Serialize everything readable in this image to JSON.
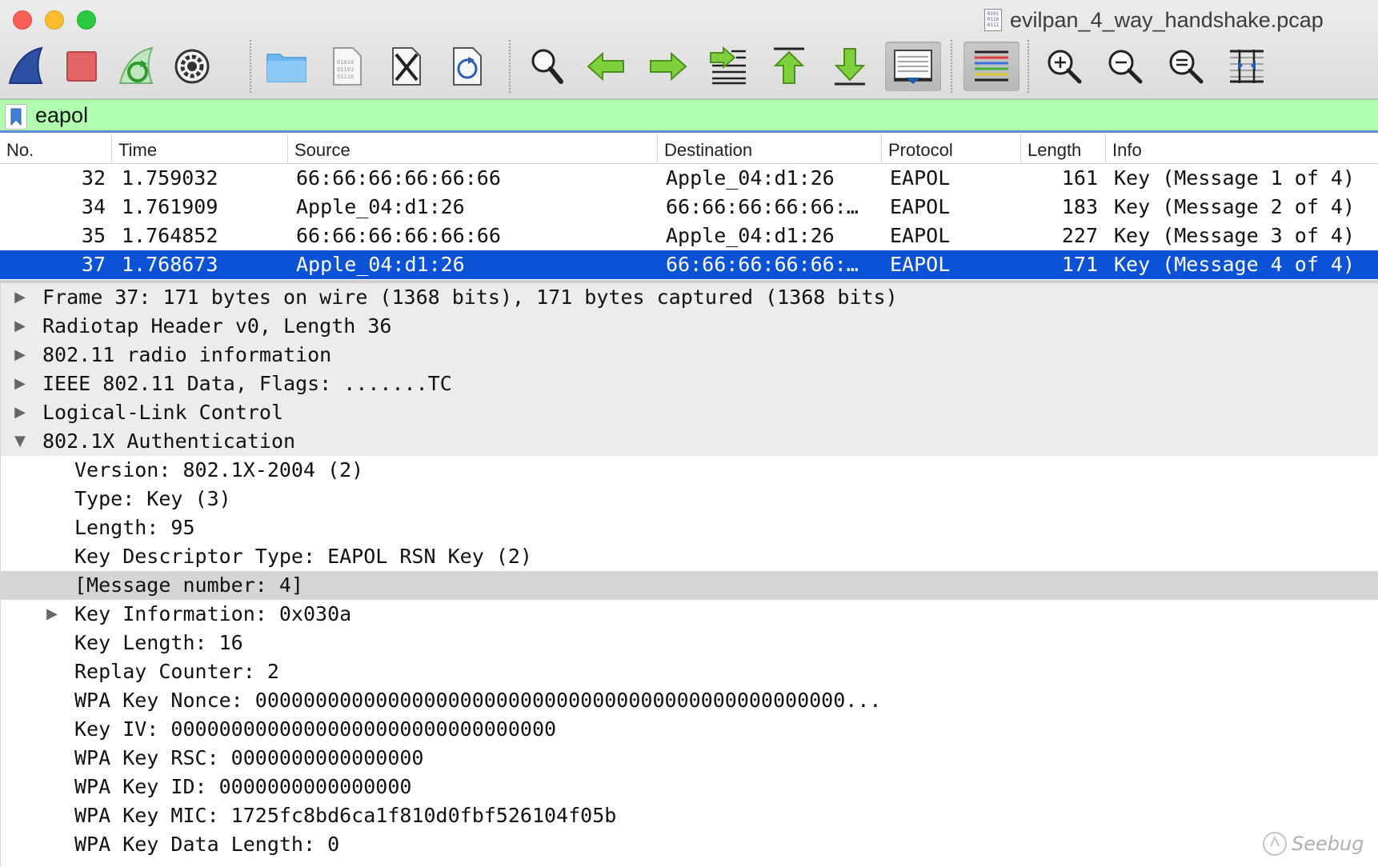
{
  "window": {
    "title": "evilpan_4_way_handshake.pcap",
    "file_icon_text": "0101\n0110\n0111"
  },
  "toolbar": {
    "buttons": [
      {
        "id": "start-capture",
        "icon": "shark-fin-icon"
      },
      {
        "id": "stop-capture",
        "icon": "stop-icon"
      },
      {
        "id": "restart-capture",
        "icon": "restart-icon"
      },
      {
        "id": "capture-options",
        "icon": "gear-icon"
      },
      {
        "id": "open-file",
        "icon": "folder-icon"
      },
      {
        "id": "save-file",
        "icon": "binary-file-icon"
      },
      {
        "id": "close-file",
        "icon": "close-file-icon"
      },
      {
        "id": "reload-file",
        "icon": "reload-file-icon"
      },
      {
        "id": "find-packet",
        "icon": "magnifier-icon"
      },
      {
        "id": "go-back",
        "icon": "arrow-left-icon"
      },
      {
        "id": "go-forward",
        "icon": "arrow-right-icon"
      },
      {
        "id": "go-to-packet",
        "icon": "jump-to-packet-icon"
      },
      {
        "id": "go-first",
        "icon": "arrow-up-icon"
      },
      {
        "id": "go-last",
        "icon": "arrow-down-icon"
      },
      {
        "id": "autoscroll",
        "icon": "autoscroll-icon"
      },
      {
        "id": "colorize",
        "icon": "colorize-icon"
      },
      {
        "id": "zoom-in",
        "icon": "zoom-in-icon"
      },
      {
        "id": "zoom-out",
        "icon": "zoom-out-icon"
      },
      {
        "id": "normal-size",
        "icon": "zoom-reset-icon"
      },
      {
        "id": "resize-columns",
        "icon": "resize-columns-icon"
      }
    ]
  },
  "filter": {
    "value": "eapol",
    "bookmark_icon": "bookmark-icon",
    "background": "#afffaf"
  },
  "packet_list": {
    "columns": [
      "No.",
      "Time",
      "Source",
      "Destination",
      "Protocol",
      "Length",
      "Info"
    ],
    "rows": [
      {
        "no": "32",
        "time": "1.759032",
        "source": "66:66:66:66:66:66",
        "destination": "Apple_04:d1:26",
        "protocol": "EAPOL",
        "length": "161",
        "info": "Key (Message 1 of 4)"
      },
      {
        "no": "34",
        "time": "1.761909",
        "source": "Apple_04:d1:26",
        "destination": "66:66:66:66:66:…",
        "protocol": "EAPOL",
        "length": "183",
        "info": "Key (Message 2 of 4)"
      },
      {
        "no": "35",
        "time": "1.764852",
        "source": "66:66:66:66:66:66",
        "destination": "Apple_04:d1:26",
        "protocol": "EAPOL",
        "length": "227",
        "info": "Key (Message 3 of 4)"
      },
      {
        "no": "37",
        "time": "1.768673",
        "source": "Apple_04:d1:26",
        "destination": "66:66:66:66:66:…",
        "protocol": "EAPOL",
        "length": "171",
        "info": "Key (Message 4 of 4)"
      }
    ],
    "selected_color": "#0b52d6"
  },
  "detail_tree": {
    "items": [
      {
        "text": "Frame 37: 171 bytes on wire (1368 bits), 171 bytes captured (1368 bits)",
        "arrow": "▶"
      },
      {
        "text": "Radiotap Header v0, Length 36",
        "arrow": "▶"
      },
      {
        "text": "802.11 radio information",
        "arrow": "▶"
      },
      {
        "text": "IEEE 802.11 Data, Flags: .......TC",
        "arrow": "▶"
      },
      {
        "text": "Logical-Link Control",
        "arrow": "▶"
      },
      {
        "text": "802.1X Authentication",
        "arrow": "▼"
      },
      {
        "text": "Version: 802.1X-2004 (2)",
        "arrow": ""
      },
      {
        "text": "Type: Key (3)",
        "arrow": ""
      },
      {
        "text": "Length: 95",
        "arrow": ""
      },
      {
        "text": "Key Descriptor Type: EAPOL RSN Key (2)",
        "arrow": ""
      },
      {
        "text": "[Message number: 4]",
        "arrow": ""
      },
      {
        "text": "Key Information: 0x030a",
        "arrow": "▶"
      },
      {
        "text": "Key Length: 16",
        "arrow": ""
      },
      {
        "text": "Replay Counter: 2",
        "arrow": ""
      },
      {
        "text": "WPA Key Nonce: 0000000000000000000000000000000000000000000000000...",
        "arrow": ""
      },
      {
        "text": "Key IV: 00000000000000000000000000000000",
        "arrow": ""
      },
      {
        "text": "WPA Key RSC: 0000000000000000",
        "arrow": ""
      },
      {
        "text": "WPA Key ID: 0000000000000000",
        "arrow": ""
      },
      {
        "text": "WPA Key MIC: 1725fc8bd6ca1f810d0fbf526104f05b",
        "arrow": ""
      },
      {
        "text": "WPA Key Data Length: 0",
        "arrow": ""
      }
    ]
  },
  "watermark": {
    "text": "Seebug"
  }
}
